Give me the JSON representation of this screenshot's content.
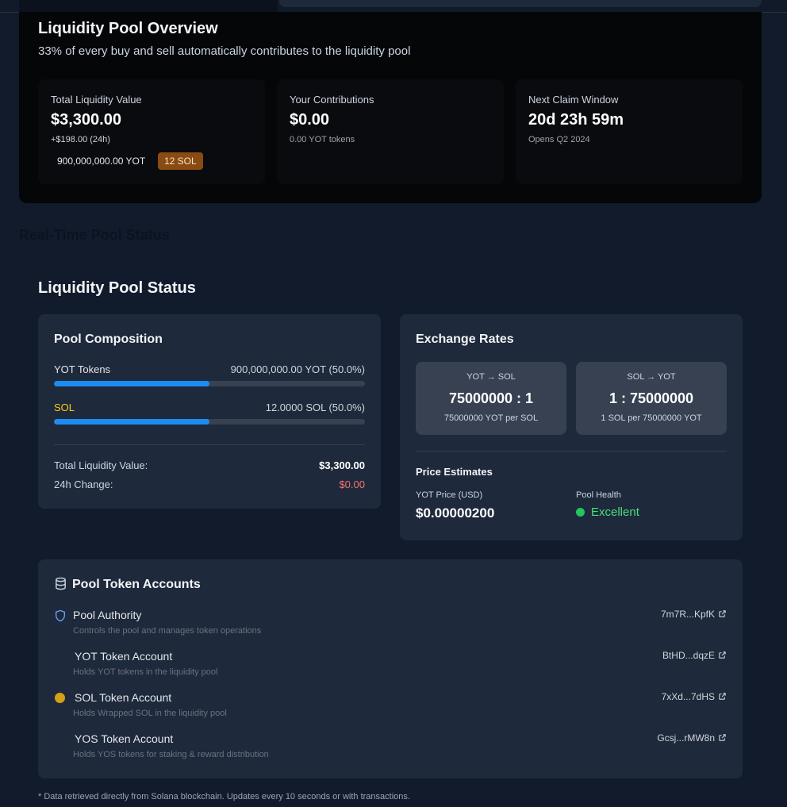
{
  "overview": {
    "title": "Liquidity Pool Overview",
    "subtitle": "33% of every buy and sell automatically contributes to the liquidity pool",
    "cards": [
      {
        "label": "Total Liquidity Value",
        "value": "$3,300.00",
        "detail": "+$198.00 (24h)"
      },
      {
        "label": "Your Contributions",
        "value": "$0.00",
        "detail": "0.00 YOT tokens"
      },
      {
        "label": "Next Claim Window",
        "value": "20d 23h 59m",
        "detail": "Opens Q2 2024"
      }
    ],
    "yot_badge": "900,000,000.00 YOT",
    "sol_badge": "12 SOL"
  },
  "section_label": "Real-Time Pool Status",
  "status": {
    "title": "Liquidity Pool Status",
    "composition": {
      "title": "Pool Composition",
      "rows": [
        {
          "name": "YOT Tokens",
          "amount": "900,000,000.00 YOT (50.0%)",
          "share": 0.5
        },
        {
          "name": "SOL",
          "amount": "12.0000 SOL (50.0%)",
          "share": 0.5
        }
      ],
      "total_label": "Total Liquidity Value:",
      "total_value": "$3,300.00",
      "change_label": "24h Change:",
      "change_value": "$0.00"
    },
    "rates": {
      "title": "Exchange Rates",
      "boxes": [
        {
          "pair": "YOT → SOL",
          "ratio": "75000000 : 1",
          "per": "75000000 YOT per SOL"
        },
        {
          "pair": "SOL → YOT",
          "ratio": "1 : 75000000",
          "per": "1 SOL per 75000000 YOT"
        }
      ],
      "estimates_title": "Price Estimates",
      "price_label": "YOT Price (USD)",
      "price_value": "$0.00000200",
      "health_label": "Pool Health",
      "health_value": "Excellent"
    },
    "accounts": {
      "title": "Pool Token Accounts",
      "items": [
        {
          "title": "Pool Authority",
          "desc": "Controls the pool and manages token operations",
          "addr": "7m7R...KpfK",
          "icon": "shield-icon"
        },
        {
          "title": "YOT Token Account",
          "desc": "Holds YOT tokens in the liquidity pool",
          "addr": "BtHD...dqzE",
          "icon": ""
        },
        {
          "title": "SOL Token Account",
          "desc": "Holds Wrapped SOL in the liquidity pool",
          "addr": "7xXd...7dHS",
          "icon": "sol-dot-icon"
        },
        {
          "title": "YOS Token Account",
          "desc": "Holds YOS tokens for staking & reward distribution",
          "addr": "Gcsj...rMW8n",
          "icon": ""
        }
      ]
    },
    "footnote": "* Data retrieved directly from Solana blockchain. Updates every 10 seconds or with transactions."
  }
}
